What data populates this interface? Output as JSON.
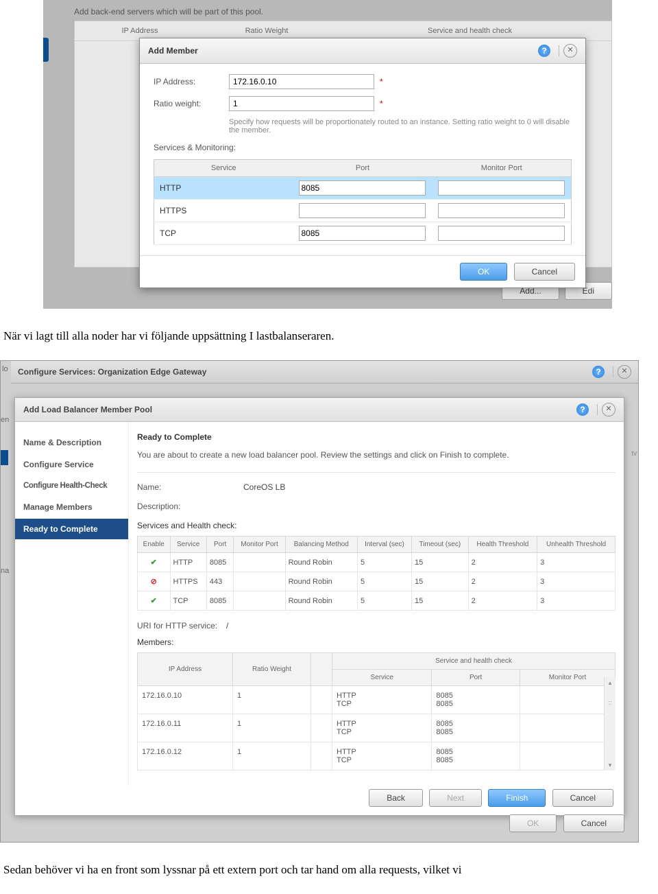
{
  "screenshot1": {
    "pool_instruction": "Add back-end servers which will be part of this pool.",
    "back_headers": {
      "ip": "IP Address",
      "ratio": "Ratio Weight",
      "shc": "Service and health check"
    },
    "modal_title": "Add Member",
    "labels": {
      "ip": "IP Address:",
      "ratio": "Ratio weight:"
    },
    "values": {
      "ip": "172.16.0.10",
      "ratio": "1"
    },
    "help_text": "Specify how requests will be proportionately routed to an instance. Setting ratio weight to 0 will disable the member.",
    "section": "Services & Monitoring:",
    "cols": {
      "service": "Service",
      "port": "Port",
      "monitor": "Monitor Port"
    },
    "rows": [
      {
        "service": "HTTP",
        "port": "8085",
        "monitor": ""
      },
      {
        "service": "HTTPS",
        "port": "",
        "monitor": ""
      },
      {
        "service": "TCP",
        "port": "8085",
        "monitor": ""
      }
    ],
    "buttons": {
      "ok": "OK",
      "cancel": "Cancel",
      "add": "Add...",
      "edit": "Edi"
    }
  },
  "narrative1": "När vi lagt till alla noder har vi följande uppsättning I lastbalanseraren.",
  "screenshot2": {
    "frag_lo": "lo",
    "frag_en": "en",
    "frag_na": "na",
    "frag_tv": "tv",
    "outer_title": "Configure Services: Organization Edge Gateway",
    "inner_title": "Add Load Balancer Member Pool",
    "steps": [
      "Name & Description",
      "Configure Service",
      "Configure Health-Check",
      "Manage Members",
      "Ready to Complete"
    ],
    "main": {
      "heading": "Ready to Complete",
      "intro": "You are about to create a new load balancer pool. Review the settings and click on Finish to complete.",
      "name_label": "Name:",
      "name_value": "CoreOS LB",
      "desc_label": "Description:",
      "shc_label": "Services and Health check:",
      "svc_cols": [
        "Enable",
        "Service",
        "Port",
        "Monitor Port",
        "Balancing Method",
        "Interval (sec)",
        "Timeout (sec)",
        "Health Threshold",
        "Unhealth Threshold"
      ],
      "svc_rows": [
        {
          "enable": "check",
          "service": "HTTP",
          "port": "8085",
          "monitor": "",
          "method": "Round Robin",
          "interval": "5",
          "timeout": "15",
          "ht": "2",
          "ut": "3"
        },
        {
          "enable": "nope",
          "service": "HTTPS",
          "port": "443",
          "monitor": "",
          "method": "Round Robin",
          "interval": "5",
          "timeout": "15",
          "ht": "2",
          "ut": "3"
        },
        {
          "enable": "check",
          "service": "TCP",
          "port": "8085",
          "monitor": "",
          "method": "Round Robin",
          "interval": "5",
          "timeout": "15",
          "ht": "2",
          "ut": "3"
        }
      ],
      "uri_label": "URI for HTTP service:",
      "uri_value": "/",
      "members_label": "Members:",
      "mem_cols": {
        "ip": "IP Address",
        "ratio": "Ratio Weight",
        "shc": "Service and health check",
        "service": "Service",
        "port": "Port",
        "monitor": "Monitor Port"
      },
      "mem_rows": [
        {
          "ip": "172.16.0.10",
          "ratio": "1",
          "service": "HTTP\nTCP",
          "port": "8085\n8085",
          "monitor": ""
        },
        {
          "ip": "172.16.0.11",
          "ratio": "1",
          "service": "HTTP\nTCP",
          "port": "8085\n8085",
          "monitor": ""
        },
        {
          "ip": "172.16.0.12",
          "ratio": "1",
          "service": "HTTP\nTCP",
          "port": "8085\n8085",
          "monitor": ""
        }
      ]
    },
    "buttons": {
      "back": "Back",
      "next": "Next",
      "finish": "Finish",
      "cancel": "Cancel",
      "ok": "OK",
      "cancel2": "Cancel"
    }
  },
  "narrative2": "Sedan behöver vi ha en front som lyssnar på ett extern port och tar hand om alla requests, vilket vi"
}
